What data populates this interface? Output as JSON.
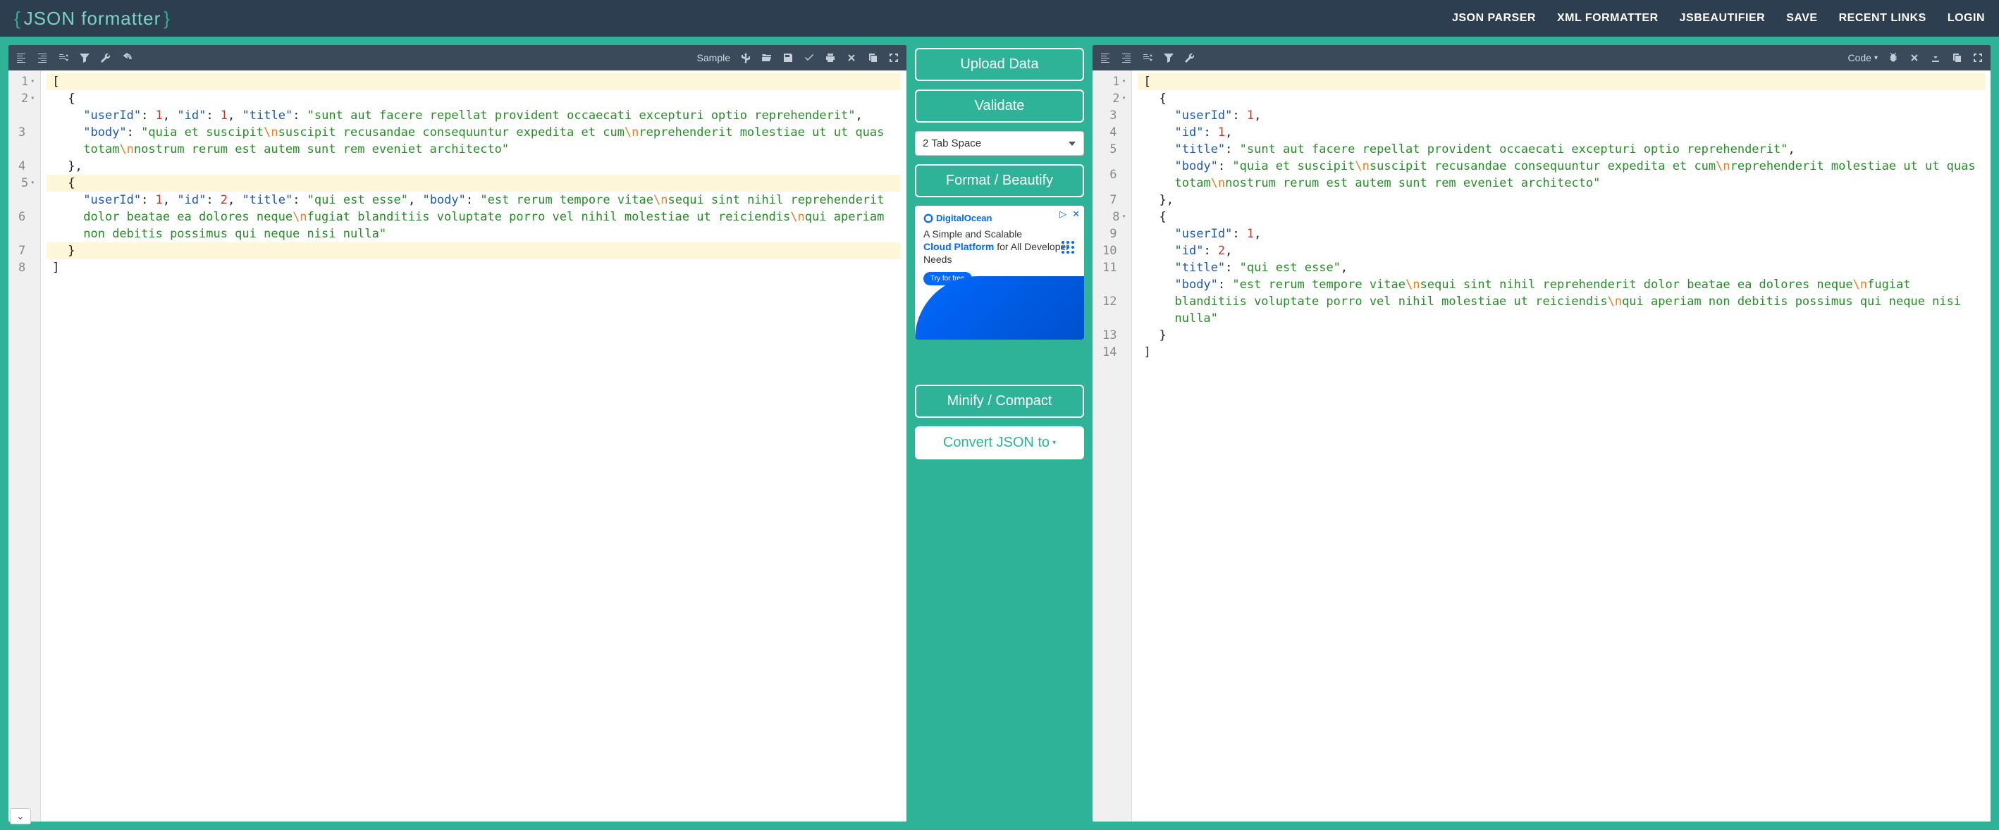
{
  "header": {
    "logo": "JSON formatter",
    "nav": [
      "JSON PARSER",
      "XML FORMATTER",
      "JSBEAUTIFIER",
      "SAVE",
      "RECENT LINKS",
      "LOGIN"
    ]
  },
  "center": {
    "upload": "Upload Data",
    "validate": "Validate",
    "tab_space": "2 Tab Space",
    "format": "Format / Beautify",
    "minify": "Minify / Compact",
    "convert": "Convert JSON to",
    "ad": {
      "brand": "DigitalOcean",
      "line1": "A Simple and Scalable",
      "line2_bold": "Cloud Platform",
      "line2_rest": " for All Developer Needs",
      "cta": "Try for free"
    }
  },
  "left_toolbar": {
    "sample_label": "Sample"
  },
  "right_toolbar": {
    "code_label": "Code"
  },
  "left_editor": {
    "lines": [
      {
        "num": 1,
        "fold": true,
        "hl": true,
        "tokens": [
          {
            "t": "p",
            "v": "["
          }
        ]
      },
      {
        "num": 2,
        "fold": true,
        "indent": 1,
        "tokens": [
          {
            "t": "p",
            "v": "{"
          }
        ]
      },
      {
        "num": 3,
        "indent": 2,
        "tokens": [
          {
            "t": "k",
            "v": "\"userId\""
          },
          {
            "t": "p",
            "v": ": "
          },
          {
            "t": "n",
            "v": "1"
          },
          {
            "t": "p",
            "v": ", "
          },
          {
            "t": "k",
            "v": "\"id\""
          },
          {
            "t": "p",
            "v": ": "
          },
          {
            "t": "n",
            "v": "1"
          },
          {
            "t": "p",
            "v": ", "
          },
          {
            "t": "k",
            "v": "\"title\""
          },
          {
            "t": "p",
            "v": ": "
          },
          {
            "t": "s",
            "v": "\"sunt aut facere repellat provident occaecati excepturi optio reprehenderit\""
          },
          {
            "t": "p",
            "v": ", "
          },
          {
            "t": "k",
            "v": "\"body\""
          },
          {
            "t": "p",
            "v": ": "
          },
          {
            "t": "s",
            "v": "\"quia et suscipit"
          },
          {
            "t": "esc",
            "v": "\\n"
          },
          {
            "t": "s",
            "v": "suscipit recusandae consequuntur expedita et cum"
          },
          {
            "t": "esc",
            "v": "\\n"
          },
          {
            "t": "s",
            "v": "reprehenderit molestiae ut ut quas totam"
          },
          {
            "t": "esc",
            "v": "\\n"
          },
          {
            "t": "s",
            "v": "nostrum rerum est autem sunt rem eveniet architecto\""
          }
        ]
      },
      {
        "num": 4,
        "indent": 1,
        "tokens": [
          {
            "t": "p",
            "v": "},"
          }
        ]
      },
      {
        "num": 5,
        "fold": true,
        "indent": 1,
        "hl": true,
        "tokens": [
          {
            "t": "p",
            "v": "{"
          }
        ]
      },
      {
        "num": 6,
        "indent": 2,
        "tokens": [
          {
            "t": "k",
            "v": "\"userId\""
          },
          {
            "t": "p",
            "v": ": "
          },
          {
            "t": "n",
            "v": "1"
          },
          {
            "t": "p",
            "v": ", "
          },
          {
            "t": "k",
            "v": "\"id\""
          },
          {
            "t": "p",
            "v": ": "
          },
          {
            "t": "n",
            "v": "2"
          },
          {
            "t": "p",
            "v": ", "
          },
          {
            "t": "k",
            "v": "\"title\""
          },
          {
            "t": "p",
            "v": ": "
          },
          {
            "t": "s",
            "v": "\"qui est esse\""
          },
          {
            "t": "p",
            "v": ", "
          },
          {
            "t": "k",
            "v": "\"body\""
          },
          {
            "t": "p",
            "v": ": "
          },
          {
            "t": "s",
            "v": "\"est rerum tempore vitae"
          },
          {
            "t": "esc",
            "v": "\\n"
          },
          {
            "t": "s",
            "v": "sequi sint nihil reprehenderit dolor beatae ea dolores neque"
          },
          {
            "t": "esc",
            "v": "\\n"
          },
          {
            "t": "s",
            "v": "fugiat blanditiis voluptate porro vel nihil molestiae ut reiciendis"
          },
          {
            "t": "esc",
            "v": "\\n"
          },
          {
            "t": "s",
            "v": "qui aperiam non debitis possimus qui neque nisi nulla\""
          }
        ]
      },
      {
        "num": 7,
        "indent": 1,
        "hl": true,
        "tokens": [
          {
            "t": "p",
            "v": "}"
          }
        ]
      },
      {
        "num": 8,
        "tokens": [
          {
            "t": "p",
            "v": "]"
          }
        ]
      }
    ]
  },
  "right_editor": {
    "lines": [
      {
        "num": 1,
        "fold": true,
        "hl": true,
        "tokens": [
          {
            "t": "p",
            "v": "["
          }
        ]
      },
      {
        "num": 2,
        "fold": true,
        "indent": 1,
        "tokens": [
          {
            "t": "p",
            "v": "{"
          }
        ]
      },
      {
        "num": 3,
        "indent": 2,
        "tokens": [
          {
            "t": "k",
            "v": "\"userId\""
          },
          {
            "t": "p",
            "v": ": "
          },
          {
            "t": "n",
            "v": "1"
          },
          {
            "t": "p",
            "v": ","
          }
        ]
      },
      {
        "num": 4,
        "indent": 2,
        "tokens": [
          {
            "t": "k",
            "v": "\"id\""
          },
          {
            "t": "p",
            "v": ": "
          },
          {
            "t": "n",
            "v": "1"
          },
          {
            "t": "p",
            "v": ","
          }
        ]
      },
      {
        "num": 5,
        "indent": 2,
        "tokens": [
          {
            "t": "k",
            "v": "\"title\""
          },
          {
            "t": "p",
            "v": ": "
          },
          {
            "t": "s",
            "v": "\"sunt aut facere repellat provident occaecati excepturi optio reprehenderit\""
          },
          {
            "t": "p",
            "v": ","
          }
        ]
      },
      {
        "num": 6,
        "indent": 2,
        "tokens": [
          {
            "t": "k",
            "v": "\"body\""
          },
          {
            "t": "p",
            "v": ": "
          },
          {
            "t": "s",
            "v": "\"quia et suscipit"
          },
          {
            "t": "esc",
            "v": "\\n"
          },
          {
            "t": "s",
            "v": "suscipit recusandae consequuntur expedita et cum"
          },
          {
            "t": "esc",
            "v": "\\n"
          },
          {
            "t": "s",
            "v": "reprehenderit molestiae ut ut quas totam"
          },
          {
            "t": "esc",
            "v": "\\n"
          },
          {
            "t": "s",
            "v": "nostrum rerum est autem sunt rem eveniet architecto\""
          }
        ]
      },
      {
        "num": 7,
        "indent": 1,
        "tokens": [
          {
            "t": "p",
            "v": "},"
          }
        ]
      },
      {
        "num": 8,
        "fold": true,
        "indent": 1,
        "tokens": [
          {
            "t": "p",
            "v": "{"
          }
        ]
      },
      {
        "num": 9,
        "indent": 2,
        "tokens": [
          {
            "t": "k",
            "v": "\"userId\""
          },
          {
            "t": "p",
            "v": ": "
          },
          {
            "t": "n",
            "v": "1"
          },
          {
            "t": "p",
            "v": ","
          }
        ]
      },
      {
        "num": 10,
        "indent": 2,
        "tokens": [
          {
            "t": "k",
            "v": "\"id\""
          },
          {
            "t": "p",
            "v": ": "
          },
          {
            "t": "n",
            "v": "2"
          },
          {
            "t": "p",
            "v": ","
          }
        ]
      },
      {
        "num": 11,
        "indent": 2,
        "tokens": [
          {
            "t": "k",
            "v": "\"title\""
          },
          {
            "t": "p",
            "v": ": "
          },
          {
            "t": "s",
            "v": "\"qui est esse\""
          },
          {
            "t": "p",
            "v": ","
          }
        ]
      },
      {
        "num": 12,
        "indent": 2,
        "tokens": [
          {
            "t": "k",
            "v": "\"body\""
          },
          {
            "t": "p",
            "v": ": "
          },
          {
            "t": "s",
            "v": "\"est rerum tempore vitae"
          },
          {
            "t": "esc",
            "v": "\\n"
          },
          {
            "t": "s",
            "v": "sequi sint nihil reprehenderit dolor beatae ea dolores neque"
          },
          {
            "t": "esc",
            "v": "\\n"
          },
          {
            "t": "s",
            "v": "fugiat blanditiis voluptate porro vel nihil molestiae ut reiciendis"
          },
          {
            "t": "esc",
            "v": "\\n"
          },
          {
            "t": "s",
            "v": "qui aperiam non debitis possimus qui neque nisi nulla\""
          }
        ]
      },
      {
        "num": 13,
        "indent": 1,
        "tokens": [
          {
            "t": "p",
            "v": "}"
          }
        ]
      },
      {
        "num": 14,
        "tokens": [
          {
            "t": "p",
            "v": "]"
          }
        ]
      }
    ]
  }
}
